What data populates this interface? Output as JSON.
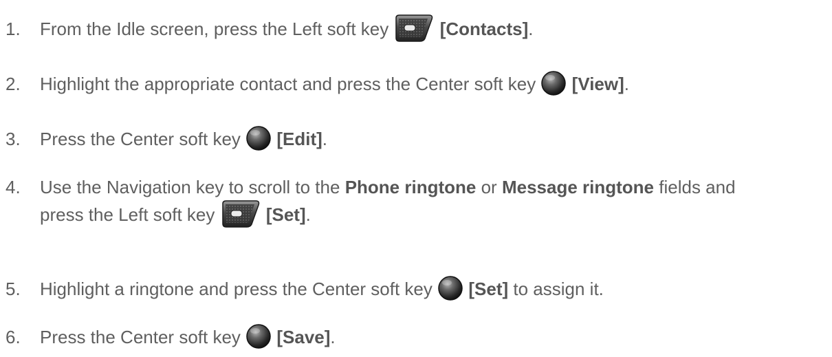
{
  "steps": [
    {
      "number": "1.",
      "text_before": "From the Idle screen, press the Left soft key",
      "key_icon": "left-soft-key-icon",
      "key_label": "[Contacts]",
      "text_after": "."
    },
    {
      "number": "2.",
      "text_before": "Highlight the appropriate contact and press the Center soft key",
      "key_icon": "center-soft-key-icon",
      "key_label": "[View]",
      "text_after": "."
    },
    {
      "number": "3.",
      "text_before": "Press the Center soft key",
      "key_icon": "center-soft-key-icon",
      "key_label": "[Edit]",
      "text_after": "."
    },
    {
      "number": "4.",
      "text_a": "Use the Navigation key to scroll to the",
      "bold_a": "Phone ringtone",
      "text_b": "or",
      "bold_b": "Message ringtone",
      "text_c": "fields and",
      "text_line2": "press the Left soft key",
      "key_icon": "left-soft-key-icon",
      "key_label": "[Set]",
      "text_after": "."
    },
    {
      "number": "5.",
      "text_before": "Highlight a ringtone and press the Center soft key",
      "key_icon": "center-soft-key-icon",
      "key_label": "[Set]",
      "text_after": "to assign it."
    },
    {
      "number": "6.",
      "text_before": "Press the Center soft key",
      "key_icon": "center-soft-key-icon",
      "key_label": "[Save]",
      "text_after": "."
    }
  ]
}
